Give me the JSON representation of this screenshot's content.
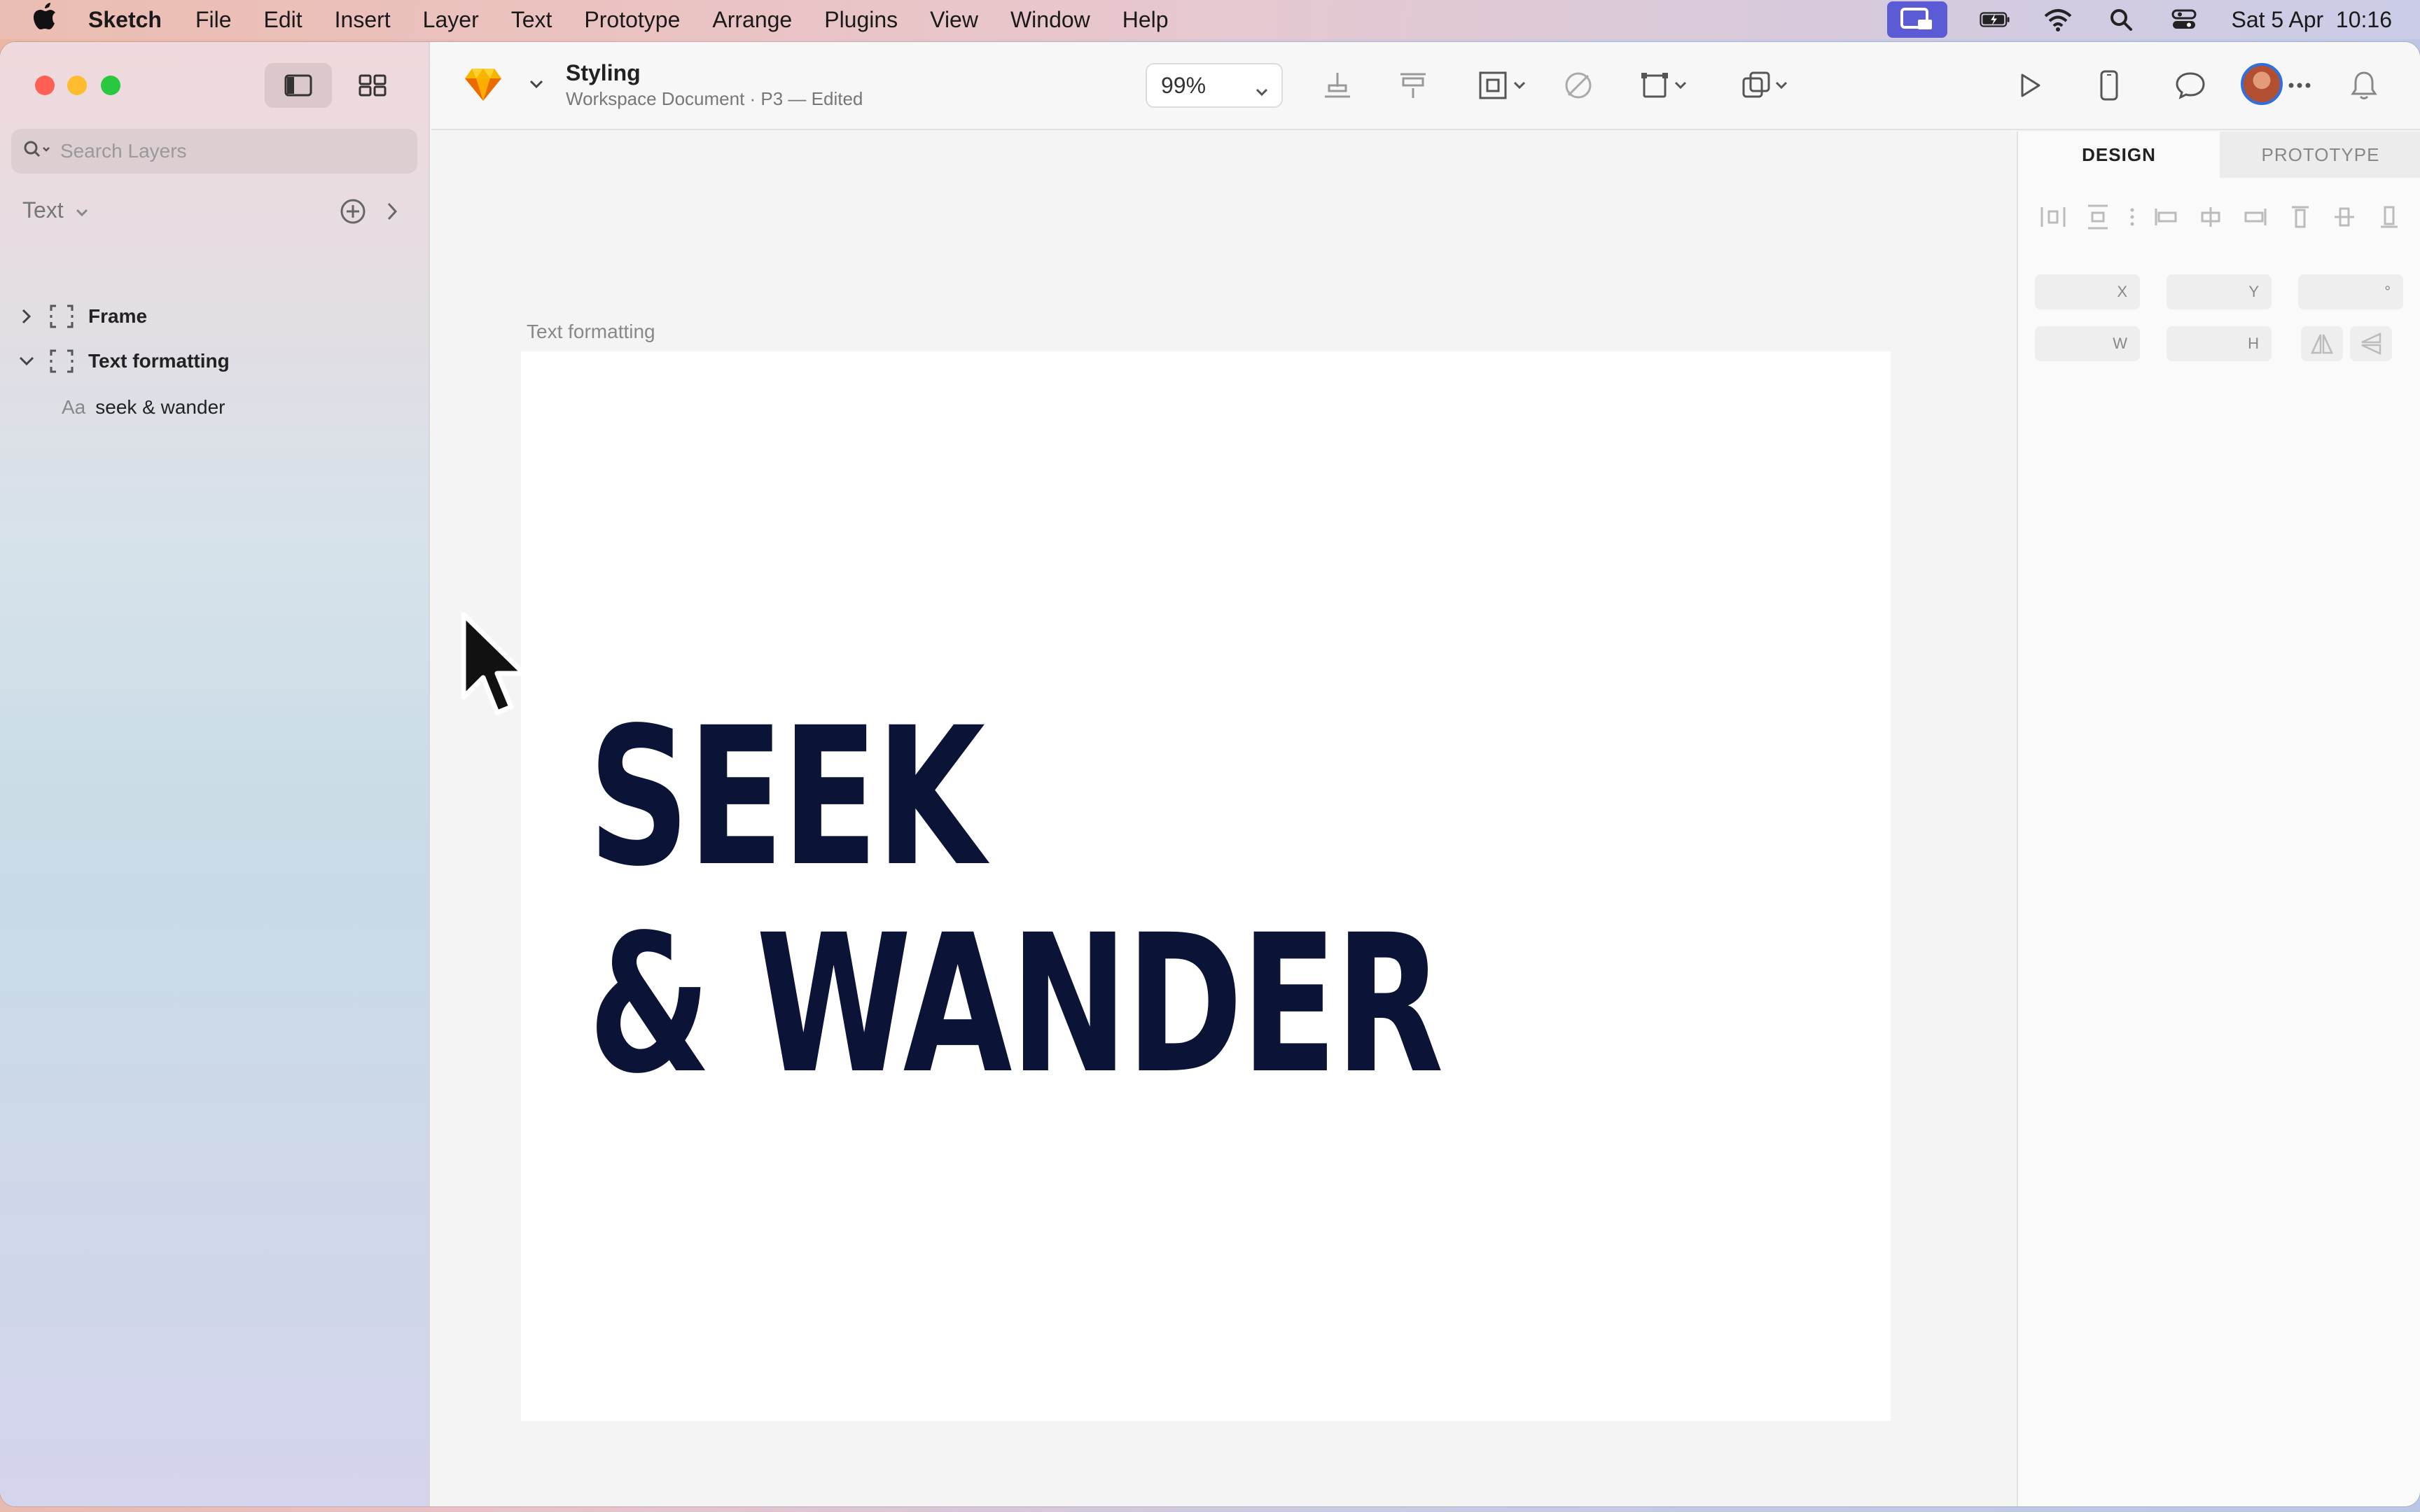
{
  "menubar": {
    "app_name": "Sketch",
    "items": [
      "File",
      "Edit",
      "Insert",
      "Layer",
      "Text",
      "Prototype",
      "Arrange",
      "Plugins",
      "View",
      "Window",
      "Help"
    ],
    "clock": "Sat 5 Apr  10:16"
  },
  "sidebar": {
    "search_placeholder": "Search Layers",
    "page_name": "Text",
    "layers": [
      {
        "name": "Frame",
        "expanded": false,
        "kind": "frame"
      },
      {
        "name": "Text formatting",
        "expanded": true,
        "kind": "frame"
      },
      {
        "name": "seek & wander",
        "kind": "text",
        "kind_label": "Aa"
      }
    ]
  },
  "toolbar": {
    "doc_title": "Styling",
    "doc_subtitle": "Workspace Document · P3 — Edited",
    "zoom": "99%"
  },
  "canvas": {
    "frame_label": "Text formatting",
    "text_lines": [
      "SEEK",
      "& WANDER"
    ],
    "text_color": "#0b1437"
  },
  "inspector": {
    "tabs": [
      "DESIGN",
      "PROTOTYPE"
    ],
    "fields": {
      "x": "X",
      "y": "Y",
      "rotation": "°",
      "w": "W",
      "h": "H"
    }
  }
}
